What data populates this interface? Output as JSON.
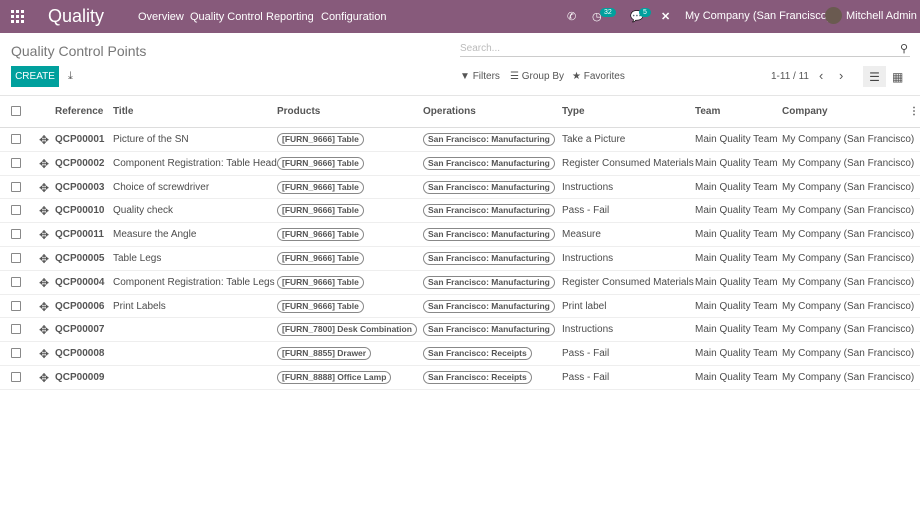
{
  "nav": {
    "app": "Quality",
    "menu": [
      "Overview",
      "Quality Control",
      "Reporting",
      "Configuration"
    ],
    "activity_count": "32",
    "message_count": "5",
    "company": "My Company (San Francisco)",
    "user": "Mitchell Admin"
  },
  "page": {
    "title": "Quality Control Points",
    "search_placeholder": "Search...",
    "create": "CREATE",
    "filters": "Filters",
    "group_by": "Group By",
    "favorites": "Favorites",
    "pager": "1-11 / 11"
  },
  "columns": {
    "reference": "Reference",
    "title": "Title",
    "products": "Products",
    "operations": "Operations",
    "type": "Type",
    "team": "Team",
    "company": "Company"
  },
  "rows": [
    {
      "ref": "QCP00001",
      "title": "Picture of the SN",
      "product": "[FURN_9666] Table",
      "op": "San Francisco: Manufacturing",
      "type": "Take a Picture",
      "team": "Main Quality Team",
      "company": "My Company (San Francisco)"
    },
    {
      "ref": "QCP00002",
      "title": "Component Registration: Table Head",
      "product": "[FURN_9666] Table",
      "op": "San Francisco: Manufacturing",
      "type": "Register Consumed Materials",
      "team": "Main Quality Team",
      "company": "My Company (San Francisco)"
    },
    {
      "ref": "QCP00003",
      "title": "Choice of screwdriver",
      "product": "[FURN_9666] Table",
      "op": "San Francisco: Manufacturing",
      "type": "Instructions",
      "team": "Main Quality Team",
      "company": "My Company (San Francisco)"
    },
    {
      "ref": "QCP00010",
      "title": "Quality check",
      "product": "[FURN_9666] Table",
      "op": "San Francisco: Manufacturing",
      "type": "Pass - Fail",
      "team": "Main Quality Team",
      "company": "My Company (San Francisco)"
    },
    {
      "ref": "QCP00011",
      "title": "Measure the Angle",
      "product": "[FURN_9666] Table",
      "op": "San Francisco: Manufacturing",
      "type": "Measure",
      "team": "Main Quality Team",
      "company": "My Company (San Francisco)"
    },
    {
      "ref": "QCP00005",
      "title": "Table Legs",
      "product": "[FURN_9666] Table",
      "op": "San Francisco: Manufacturing",
      "type": "Instructions",
      "team": "Main Quality Team",
      "company": "My Company (San Francisco)"
    },
    {
      "ref": "QCP00004",
      "title": "Component Registration: Table Legs",
      "product": "[FURN_9666] Table",
      "op": "San Francisco: Manufacturing",
      "type": "Register Consumed Materials",
      "team": "Main Quality Team",
      "company": "My Company (San Francisco)"
    },
    {
      "ref": "QCP00006",
      "title": "Print Labels",
      "product": "[FURN_9666] Table",
      "op": "San Francisco: Manufacturing",
      "type": "Print label",
      "team": "Main Quality Team",
      "company": "My Company (San Francisco)"
    },
    {
      "ref": "QCP00007",
      "title": "",
      "product": "[FURN_7800] Desk Combination",
      "op": "San Francisco: Manufacturing",
      "type": "Instructions",
      "team": "Main Quality Team",
      "company": "My Company (San Francisco)"
    },
    {
      "ref": "QCP00008",
      "title": "",
      "product": "[FURN_8855] Drawer",
      "op": "San Francisco: Receipts",
      "type": "Pass - Fail",
      "team": "Main Quality Team",
      "company": "My Company (San Francisco)"
    },
    {
      "ref": "QCP00009",
      "title": "",
      "product": "[FURN_8888] Office Lamp",
      "op": "San Francisco: Receipts",
      "type": "Pass - Fail",
      "team": "Main Quality Team",
      "company": "My Company (San Francisco)"
    }
  ]
}
